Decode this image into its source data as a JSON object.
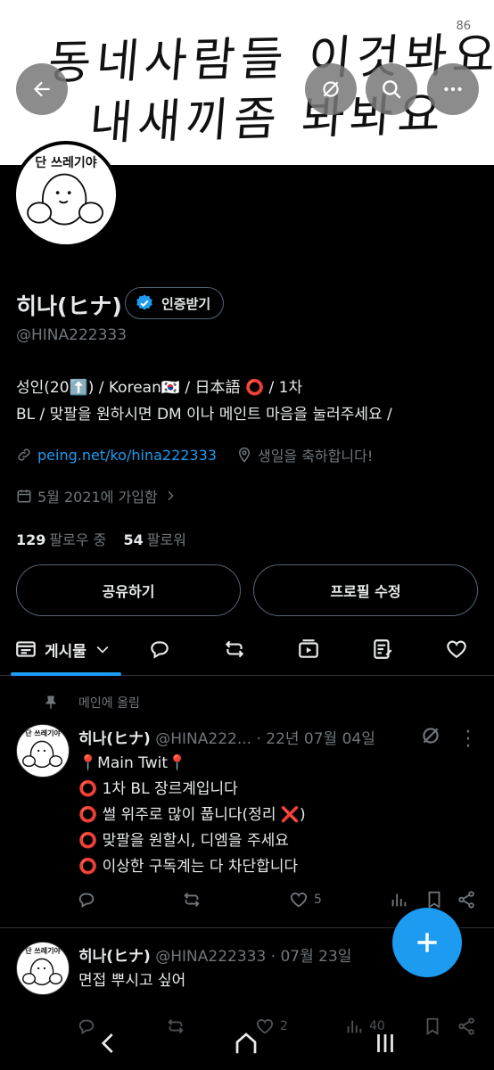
{
  "banner": {
    "line1": "동네사람들 이것봐요",
    "line2": "내새끼좀 봐봐요"
  },
  "status": {
    "number": "86"
  },
  "header_buttons": {
    "back": "back-arrow-icon",
    "grok": "grok-icon",
    "search": "search-icon",
    "more": "more-icon"
  },
  "profile": {
    "avatar_text": "단 쓰레기야",
    "name": "히나(ヒナ)",
    "verify_label": "인증받기",
    "handle": "@HINA222333",
    "bio_line1": "성인(20⬆️) / Korean🇰🇷 / 日本語 ⭕ / 1차",
    "bio_line2": "BL / 맞팔을 원하시면 DM 이나 메인트 마음을 눌러주세요 /",
    "link": "peing.net/ko/hina222333",
    "birthday": "생일을 축하합니다!",
    "joined": "5월 2021에 가입함",
    "following_count": "129",
    "following_label": "팔로우 중",
    "followers_count": "54",
    "followers_label": "팔로워",
    "share_button": "공유하기",
    "edit_button": "프로필 수정"
  },
  "tabs": {
    "posts_label": "게시물"
  },
  "pinned_label": "메인에 올림",
  "tweets": [
    {
      "name": "히나(ヒナ)",
      "handle_date": "@HINA222... · 22년 07월 04일",
      "lines": [
        "📍Main Twit📍",
        "⭕ 1차 BL 장르계입니다",
        "⭕ 썰 위주로 많이 풉니다(정리 ❌)",
        "⭕ 맞팔을 원할시, 디엠을 주세요",
        "⭕ 이상한 구독계는 다 차단합니다"
      ],
      "likes": "5"
    },
    {
      "name": "히나(ヒナ)",
      "handle_date": "@HINA222333 · 07월 23일",
      "lines": [
        "면접 뿌시고 싶어"
      ],
      "likes": "2",
      "views": "40"
    }
  ],
  "colors": {
    "accent": "#1d9bf0",
    "background": "#000000",
    "muted": "#71767b",
    "text": "#e7e9ea"
  }
}
